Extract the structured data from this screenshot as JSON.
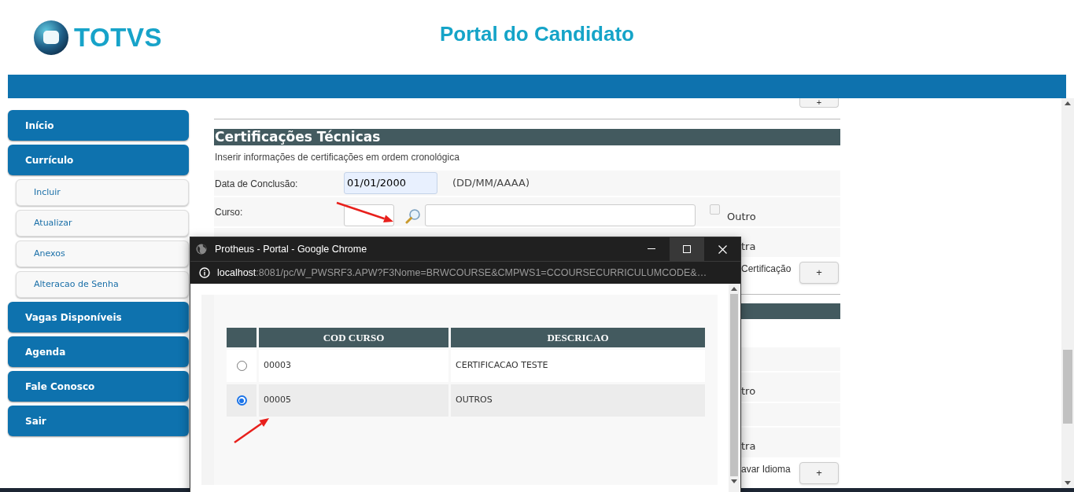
{
  "header": {
    "brand": "TOTVS",
    "title": "Portal do Candidato"
  },
  "sidebar": {
    "items": [
      {
        "label": "Início",
        "kind": "main"
      },
      {
        "label": "Currículo",
        "kind": "main"
      },
      {
        "label": "Incluir",
        "kind": "sub"
      },
      {
        "label": "Atualizar",
        "kind": "sub"
      },
      {
        "label": "Anexos",
        "kind": "sub"
      },
      {
        "label": "Alteracao de Senha",
        "kind": "sub"
      },
      {
        "label": "Vagas Disponíveis",
        "kind": "main"
      },
      {
        "label": "Agenda",
        "kind": "main"
      },
      {
        "label": "Fale Conosco",
        "kind": "main"
      },
      {
        "label": "Sair",
        "kind": "main"
      }
    ]
  },
  "content": {
    "top_button": "+",
    "section": {
      "title": "Certificações Técnicas",
      "description": "Inserir informações de certificações em ordem cronológica",
      "date": {
        "label": "Data de Conclusão:",
        "value": "01/01/2000",
        "hint": "(DD/MM/AAAA)"
      },
      "course": {
        "label": "Curso:",
        "other": {
          "label": "Outro",
          "checked": false
        }
      }
    },
    "partial_rows": [
      {
        "kind": "option",
        "text": "tra"
      },
      {
        "kind": "action",
        "text": "Certificação",
        "button": "+"
      },
      {
        "kind": "divider"
      },
      {
        "kind": "heading"
      },
      {
        "kind": "blank"
      },
      {
        "kind": "field"
      },
      {
        "kind": "option",
        "text": "tro"
      },
      {
        "kind": "field"
      },
      {
        "kind": "option",
        "text": "tra"
      },
      {
        "kind": "action",
        "text": "avar Idioma",
        "button": "+"
      }
    ]
  },
  "popup": {
    "title": "Protheus - Portal - Google Chrome",
    "url_host": "localhost",
    "url_rest": ":8081/pc/W_PWSRF3.APW?F3Nome=BRWCOURSE&CMPWS1=CCOURSECURRICULUMCODE&…",
    "table": {
      "columns": [
        "COD CURSO",
        "DESCRICAO"
      ],
      "rows": [
        {
          "code": "00003",
          "description": "CERTIFICACAO TESTE",
          "selected": false
        },
        {
          "code": "00005",
          "description": "OUTROS",
          "selected": true
        }
      ]
    }
  }
}
